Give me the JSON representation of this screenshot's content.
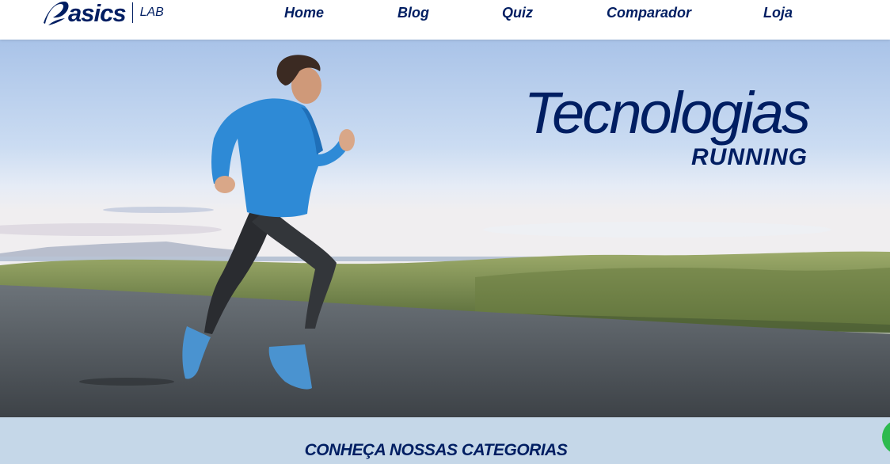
{
  "brand": {
    "logo_text": "asics",
    "sub_text": "LAB",
    "colors": {
      "navy": "#001e62",
      "category_band": "#c5d7e8",
      "chat_green": "#2dba4e"
    }
  },
  "nav": {
    "items": [
      "Home",
      "Blog",
      "Quiz",
      "Comparador",
      "Loja"
    ]
  },
  "hero": {
    "title": "Tecnologias",
    "subtitle": "RUNNING"
  },
  "categories": {
    "heading_prefix": "CONHEÇA ",
    "heading_bold": "NOSSAS CATEGORIAS"
  },
  "icons": {
    "logo": "asics-swoosh-icon",
    "chat": "chat-bubble-icon"
  }
}
